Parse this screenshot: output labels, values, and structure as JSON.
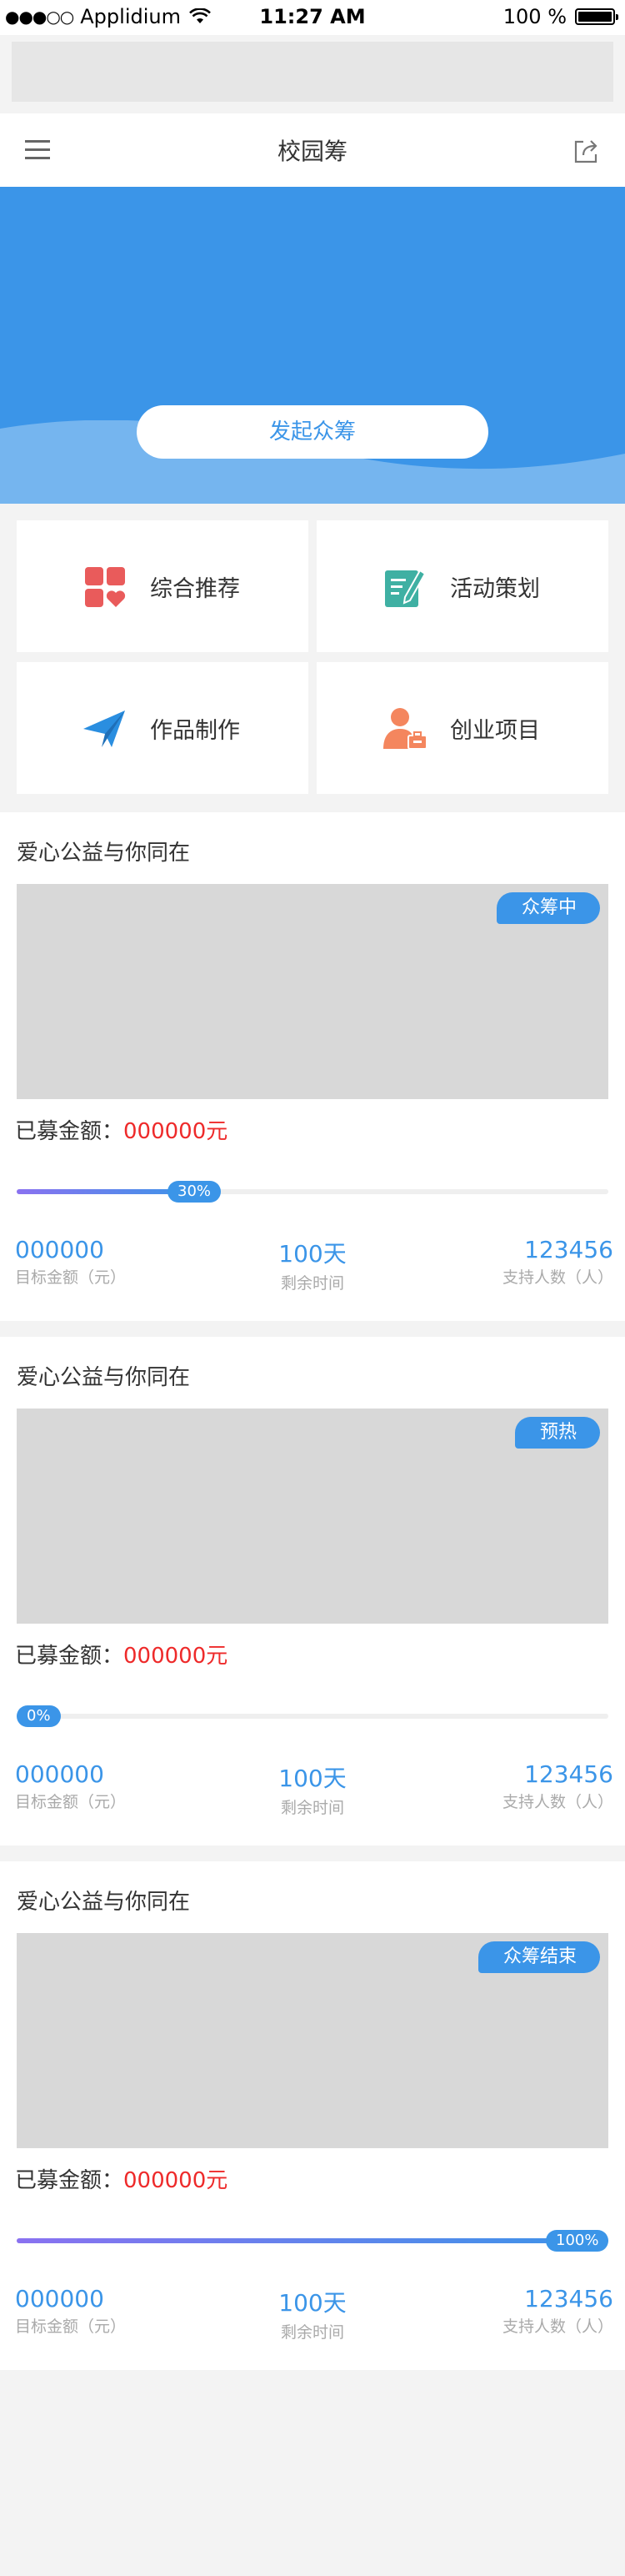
{
  "status_bar": {
    "carrier": "Applidium",
    "time": "11:27 AM",
    "battery": "100 %"
  },
  "navbar": {
    "title": "校园筹"
  },
  "banner": {
    "button_label": "发起众筹"
  },
  "categories": [
    {
      "label": "综合推荐",
      "icon": "grid-heart-icon",
      "color": "#e95b5b"
    },
    {
      "label": "活动策划",
      "icon": "edit-note-icon",
      "color": "#3fb0a3"
    },
    {
      "label": "作品制作",
      "icon": "paper-plane-icon",
      "color": "#2a8ee0"
    },
    {
      "label": "创业项目",
      "icon": "person-briefcase-icon",
      "color": "#f4865e"
    }
  ],
  "projects": [
    {
      "title": "爱心公益与你同在",
      "status": "众筹中",
      "raised_label": "已募金额：",
      "raised_amount": "000000元",
      "progress_percent": 30,
      "progress_label": "30%",
      "target_value": "000000",
      "target_label": "目标金额（元）",
      "time_value": "100天",
      "time_label": "剩余时间",
      "supporters_value": "123456",
      "supporters_label": "支持人数（人）"
    },
    {
      "title": "爱心公益与你同在",
      "status": "预热",
      "raised_label": "已募金额：",
      "raised_amount": "000000元",
      "progress_percent": 0,
      "progress_label": "0%",
      "target_value": "000000",
      "target_label": "目标金额（元）",
      "time_value": "100天",
      "time_label": "剩余时间",
      "supporters_value": "123456",
      "supporters_label": "支持人数（人）"
    },
    {
      "title": "爱心公益与你同在",
      "status": "众筹结束",
      "raised_label": "已募金额：",
      "raised_amount": "000000元",
      "progress_percent": 100,
      "progress_label": "100%",
      "target_value": "000000",
      "target_label": "目标金额（元）",
      "time_value": "100天",
      "time_label": "剩余时间",
      "supporters_value": "123456",
      "supporters_label": "支持人数（人）"
    }
  ],
  "colors": {
    "accent": "#3b95e8",
    "amount": "#ee2a2a"
  }
}
